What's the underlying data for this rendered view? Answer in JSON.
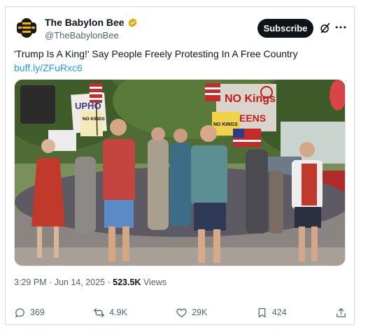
{
  "account": {
    "display_name": "The Babylon Bee",
    "handle": "@TheBabylonBee",
    "verified": true,
    "brand_color": "#f2b400"
  },
  "header": {
    "subscribe_label": "Subscribe",
    "grok_icon": "grok-icon",
    "more_icon": "more-icon"
  },
  "tweet": {
    "text": "'Trump Is A King!' Say People Freely Protesting In A Free Country ",
    "link_text": "buff.ly/ZFuRxc6"
  },
  "media": {
    "signs": {
      "uphold": "UPHO",
      "no_kinds": "NO KINDS",
      "no_kings": "NO KINGS",
      "red_banner": "NO Kings",
      "red_banner_sub": "QUEENS"
    }
  },
  "meta": {
    "time": "3:29 PM",
    "separator1": "·",
    "date": "Jun 14, 2025",
    "separator2": "·",
    "views_count": "523.5K",
    "views_label": "Views"
  },
  "actions": {
    "replies": "369",
    "reposts": "4.9K",
    "likes": "29K",
    "bookmarks": "424"
  },
  "colors": {
    "text_primary": "#0f1419",
    "text_secondary": "#536471",
    "link": "#1d9bf0",
    "verified_badge": "#e8a800"
  }
}
